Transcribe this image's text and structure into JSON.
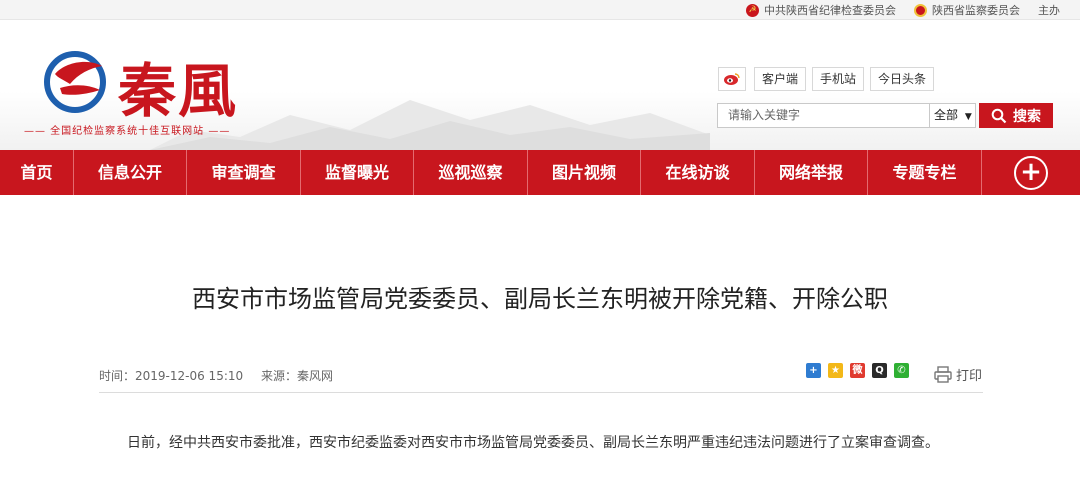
{
  "topbar": {
    "links": [
      {
        "label": "中共陕西省纪律检查委员会",
        "icon": "party-emblem-icon"
      },
      {
        "label": "陕西省监察委员会",
        "icon": "national-emblem-icon"
      },
      {
        "label": "主办"
      }
    ]
  },
  "brand": {
    "name": "秦風",
    "slogan": "—— 全国纪检监察系统十佳互联网站 ——",
    "accent_color": "#c8161e"
  },
  "header": {
    "weibo_icon": "weibo-icon",
    "pills": [
      "客户端",
      "手机站",
      "今日头条"
    ]
  },
  "search": {
    "placeholder": "请输入关键字",
    "scope": "全部",
    "button_label": "搜索"
  },
  "nav": {
    "items": [
      "首页",
      "信息公开",
      "审查调查",
      "监督曝光",
      "巡视巡察",
      "图片视频",
      "在线访谈",
      "网络举报",
      "专题专栏"
    ],
    "more_icon": "plus-icon"
  },
  "article": {
    "title": "西安市市场监管局党委委员、副局长兰东明被开除党籍、开除公职",
    "time": "时间：2019-12-06 15:10",
    "source": "来源：秦风网",
    "share_icons": [
      "add-share-icon",
      "qzone-icon",
      "weibo-share-icon",
      "qq-icon",
      "wechat-icon"
    ],
    "print_label": "打印",
    "body": "日前，经中共西安市委批准，西安市纪委监委对西安市市场监管局党委委员、副局长兰东明严重违纪违法问题进行了立案审查调查。"
  }
}
